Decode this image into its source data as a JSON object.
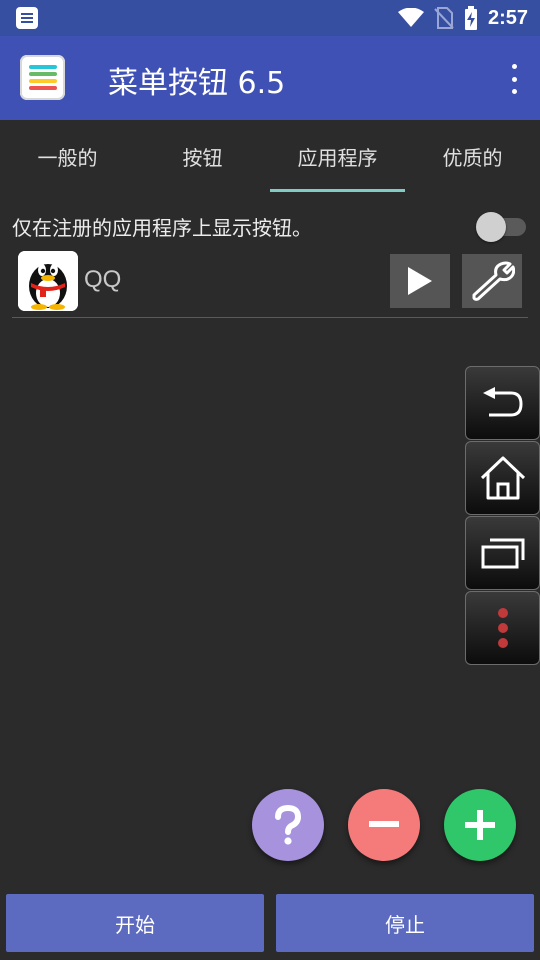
{
  "status_bar": {
    "time": "2:57",
    "icons": [
      "notification-icon",
      "wifi-icon",
      "no-sim-icon",
      "battery-charging-icon"
    ]
  },
  "app_bar": {
    "title": "菜单按钮 6.5",
    "icon": "menu-button-app-icon",
    "overflow_icon": "more-vert-icon"
  },
  "tabs": [
    {
      "label": "一般的",
      "active": false
    },
    {
      "label": "按钮",
      "active": false
    },
    {
      "label": "应用程序",
      "active": true
    },
    {
      "label": "优质的",
      "active": false
    }
  ],
  "register_toggle": {
    "label": "仅在注册的应用程序上显示按钮。",
    "checked": false
  },
  "apps": [
    {
      "name": "QQ",
      "icon": "qq-penguin-icon",
      "actions": [
        "play-icon",
        "wrench-icon"
      ]
    }
  ],
  "side_buttons": [
    "back-icon",
    "home-icon",
    "recents-icon",
    "more-dots-icon"
  ],
  "fabs": {
    "help": "?",
    "remove": "−",
    "add": "+"
  },
  "colors": {
    "status_bar": "#364fa0",
    "app_bar": "#3f51b5",
    "background": "#2b2b2b",
    "tab_indicator": "#80cbc4",
    "fab_help": "#a792dd",
    "fab_remove": "#f57b7b",
    "fab_add": "#2fc76a",
    "bottom_button": "#5c6bc0"
  },
  "bottom": {
    "start_label": "开始",
    "stop_label": "停止"
  }
}
